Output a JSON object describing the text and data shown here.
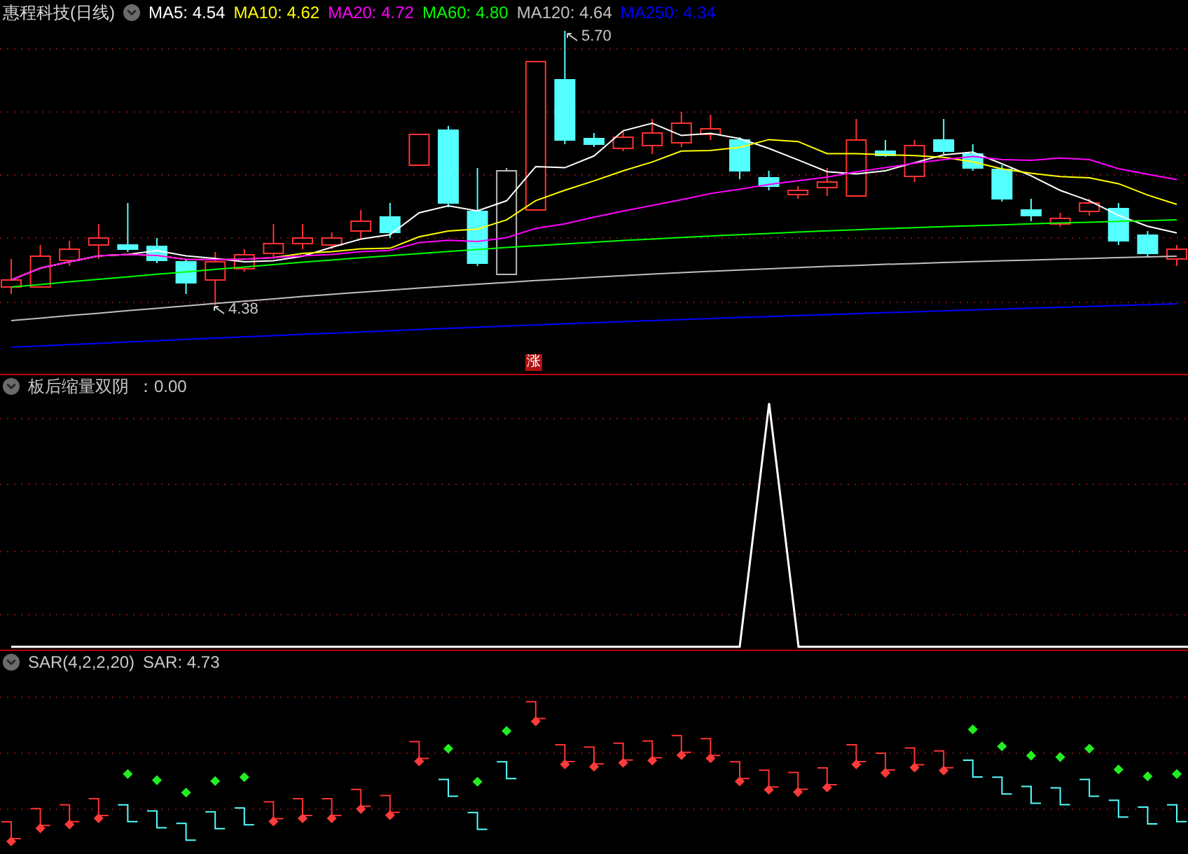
{
  "main_panel": {
    "title": "惠程科技(日线)",
    "indicators": [
      {
        "label": "MA5: 4.54",
        "color": "#ffffff"
      },
      {
        "label": "MA10: 4.62",
        "color": "#ffff00"
      },
      {
        "label": "MA20: 4.72",
        "color": "#ff00ff"
      },
      {
        "label": "MA60: 4.80",
        "color": "#00ff00"
      },
      {
        "label": "MA120: 4.64",
        "color": "#c0c0c0"
      },
      {
        "label": "MA250: 4.34",
        "color": "#0000ff"
      }
    ],
    "high_label": "5.70",
    "low_label": "4.38",
    "limit_up_marker": "涨"
  },
  "indicator_panel": {
    "name": "板后缩量双阴",
    "value": "：0.00"
  },
  "sar_panel": {
    "name": "SAR(4,2,2,20)",
    "value": "SAR: 4.73"
  }
}
